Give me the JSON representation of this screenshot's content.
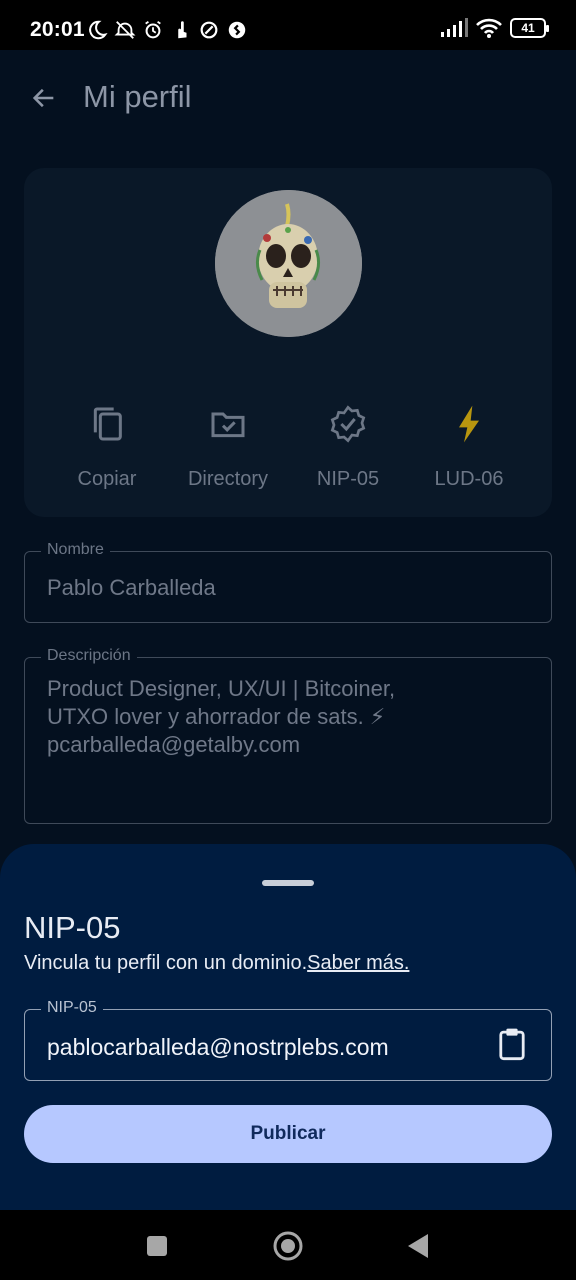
{
  "status": {
    "time": "20:01",
    "battery": "41"
  },
  "header": {
    "title": "Mi perfil"
  },
  "profile": {
    "actions": [
      {
        "label": "Copiar",
        "icon": "copy-icon"
      },
      {
        "label": "Directory",
        "icon": "folder-check-icon"
      },
      {
        "label": "NIP-05",
        "icon": "verified-badge-icon"
      },
      {
        "label": "LUD-06",
        "icon": "lightning-icon"
      }
    ],
    "name_label": "Nombre",
    "name_value": "Pablo Carballeda",
    "description_label": "Descripción",
    "description_lines": [
      "Product Designer, UX/UI | Bitcoiner,",
      "UTXO lover y ahorrador de sats. ⚡",
      "pcarballeda@getalby.com"
    ]
  },
  "sheet": {
    "title": "NIP-05",
    "subtitle": "Vincula tu perfil con un dominio.",
    "link": "Saber más.",
    "field_label": "NIP-05",
    "field_value": "pablocarballeda@nostrplebs.com",
    "publish_label": "Publicar"
  },
  "colors": {
    "accent": "#b6c8ff",
    "sheet_bg": "#001c40",
    "screen_bg": "#04101f",
    "lightning": "#b8960f"
  }
}
